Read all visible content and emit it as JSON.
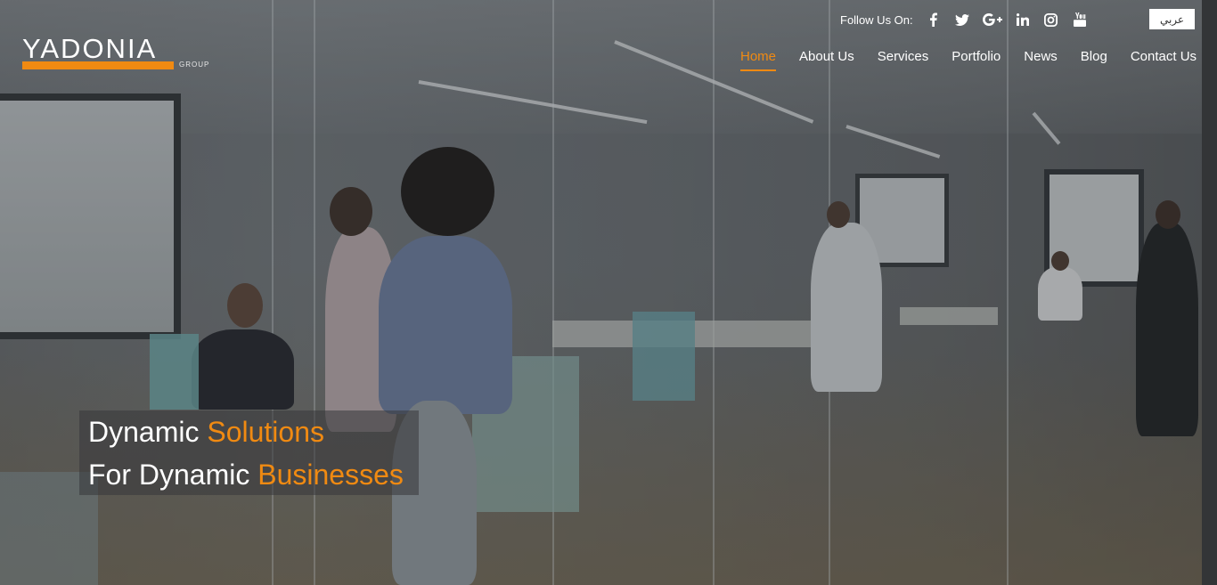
{
  "brand": {
    "name": "YADONIA",
    "sub": "GROUP",
    "accent_color": "#f08a12"
  },
  "header": {
    "follow_label": "Follow Us On:",
    "social": [
      {
        "icon": "facebook-icon"
      },
      {
        "icon": "twitter-icon"
      },
      {
        "icon": "google-plus-icon"
      },
      {
        "icon": "linkedin-icon"
      },
      {
        "icon": "instagram-icon"
      },
      {
        "icon": "youtube-icon"
      }
    ],
    "language_button": "عربي"
  },
  "nav": {
    "items": [
      {
        "label": "Home",
        "active": true
      },
      {
        "label": "About Us",
        "active": false
      },
      {
        "label": "Services",
        "active": false
      },
      {
        "label": "Portfolio",
        "active": false
      },
      {
        "label": "News",
        "active": false
      },
      {
        "label": "Blog",
        "active": false
      },
      {
        "label": "Contact Us",
        "active": false
      }
    ]
  },
  "hero": {
    "line1_a": "Dynamic ",
    "line1_b": "Solutions",
    "line2_a": "For Dynamic ",
    "line2_b": "Businesses"
  }
}
